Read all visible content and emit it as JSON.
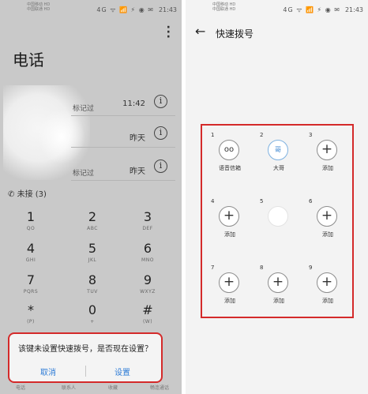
{
  "status_bar": {
    "carrier_line1": "中国移动 HD",
    "carrier_line2": "中国联通 HD",
    "glyphs": "4G ᯤ 📶 ⚡ ◉ ✉",
    "time": "21:43"
  },
  "phone_app": {
    "title": "电话",
    "menu_icon": "more-vertical-icon",
    "calls": [
      {
        "subtitle": "标记过",
        "time": "11:42"
      },
      {
        "subtitle": "",
        "time": "昨天"
      },
      {
        "subtitle": "标记过",
        "time": "昨天"
      }
    ],
    "missed_label": "未接 (3)",
    "keypad": [
      {
        "digit": "1",
        "letters": "QO"
      },
      {
        "digit": "2",
        "letters": "ABC"
      },
      {
        "digit": "3",
        "letters": "DEF"
      },
      {
        "digit": "4",
        "letters": "GHI"
      },
      {
        "digit": "5",
        "letters": "JKL"
      },
      {
        "digit": "6",
        "letters": "MNO"
      },
      {
        "digit": "7",
        "letters": "PQRS"
      },
      {
        "digit": "8",
        "letters": "TUV"
      },
      {
        "digit": "9",
        "letters": "WXYZ"
      },
      {
        "digit": "*",
        "letters": "(P)"
      },
      {
        "digit": "0",
        "letters": "+"
      },
      {
        "digit": "#",
        "letters": "(W)"
      }
    ],
    "dialog": {
      "message": "该键未设置快速拨号，是否现在设置？",
      "cancel": "取消",
      "confirm": "设置"
    },
    "bottom_tabs": [
      "电话",
      "联系人",
      "收藏",
      "畅连通话"
    ]
  },
  "speed_dial": {
    "back_icon": "arrow-left-icon",
    "title": "快速拨号",
    "cells": [
      {
        "num": "1",
        "icon": "voicemail-icon",
        "glyph": "oo",
        "label": "语音信箱"
      },
      {
        "num": "2",
        "icon": "contact-avatar",
        "glyph": "哥",
        "label": "大哥"
      },
      {
        "num": "3",
        "icon": "plus-icon",
        "glyph": "+",
        "label": "添加"
      },
      {
        "num": "4",
        "icon": "plus-icon",
        "glyph": "+",
        "label": "添加"
      },
      {
        "num": "5",
        "icon": "empty-slot",
        "glyph": "",
        "label": ""
      },
      {
        "num": "6",
        "icon": "plus-icon",
        "glyph": "+",
        "label": "添加"
      },
      {
        "num": "7",
        "icon": "plus-icon",
        "glyph": "+",
        "label": "添加"
      },
      {
        "num": "8",
        "icon": "plus-icon",
        "glyph": "+",
        "label": "添加"
      },
      {
        "num": "9",
        "icon": "plus-icon",
        "glyph": "+",
        "label": "添加"
      }
    ]
  }
}
